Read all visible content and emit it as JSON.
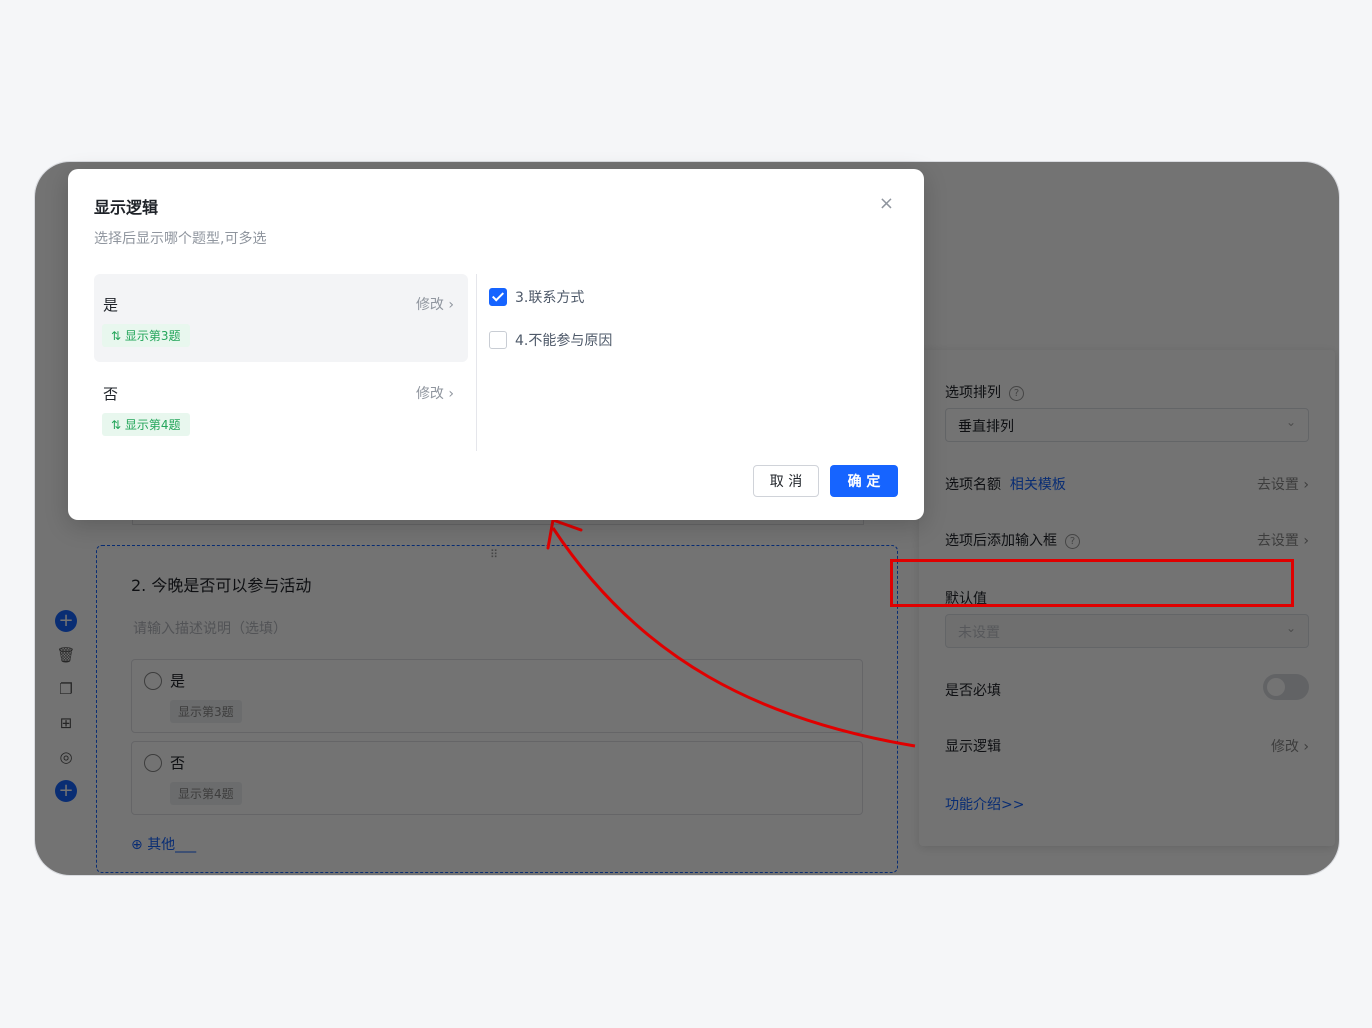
{
  "modal": {
    "title": "显示逻辑",
    "subtitle": "选择后显示哪个题型,可多选",
    "close_icon": "×",
    "conditions": [
      {
        "name": "是",
        "edit": "修改 ›",
        "tag": "显示第3题"
      },
      {
        "name": "否",
        "edit": "修改 ›",
        "tag": "显示第4题"
      }
    ],
    "targets": [
      {
        "label": "3.联系方式",
        "checked": true
      },
      {
        "label": "4.不能参与原因",
        "checked": false
      }
    ],
    "cancel_label": "取 消",
    "ok_label": "确 定"
  },
  "question": {
    "title": "2. 今晚是否可以参与活动",
    "description_placeholder": "请输入描述说明（选填）",
    "options": [
      {
        "label": "是",
        "tag": "显示第3题"
      },
      {
        "label": "否",
        "tag": "显示第4题"
      }
    ],
    "other_label": "其他___",
    "handle": "⠿"
  },
  "panel": {
    "arrangement_label": "选项排列",
    "arrangement_value": "垂直排列",
    "quota_label": "选项名额",
    "quota_link": "相关模板",
    "quota_action": "去设置 ›",
    "input_label": "选项后添加输入框",
    "input_action": "去设置 ›",
    "default_label": "默认值",
    "default_value": "未设置",
    "required_label": "是否必填",
    "logic_label": "显示逻辑",
    "logic_action": "修改 ›",
    "intro_link": "功能介绍>>"
  },
  "colors": {
    "accent": "#1664ff",
    "tag_green": "#23a55a",
    "highlight": "#e00000"
  }
}
